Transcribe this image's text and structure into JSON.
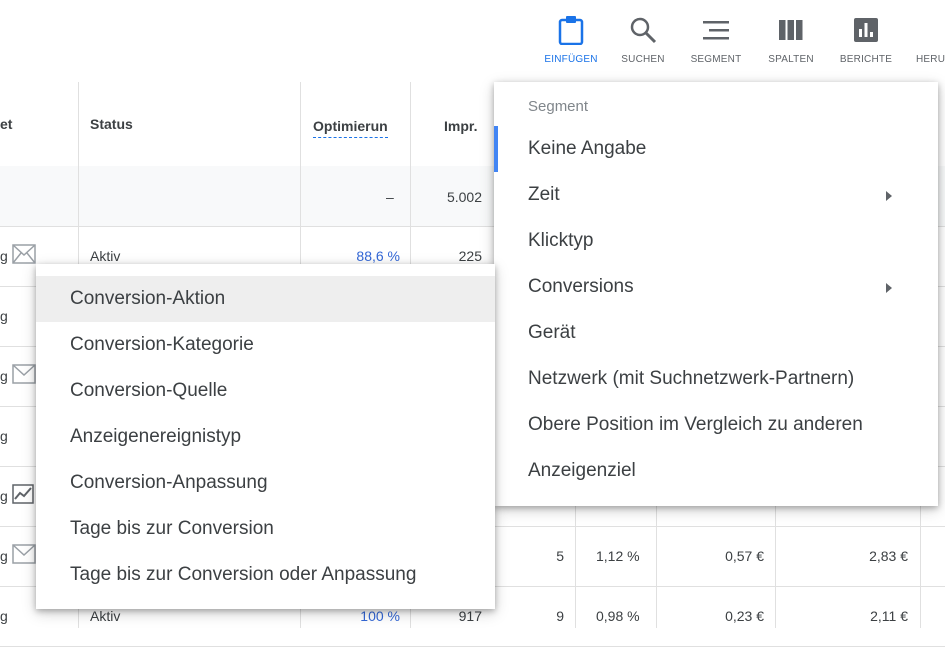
{
  "toolbar": {
    "items": [
      {
        "label": "EINFÜGEN",
        "icon": "clipboard-icon",
        "active": true
      },
      {
        "label": "SUCHEN",
        "icon": "search-icon"
      },
      {
        "label": "SEGMENT",
        "icon": "segment-icon"
      },
      {
        "label": "SPALTEN",
        "icon": "columns-icon"
      },
      {
        "label": "BERICHTE",
        "icon": "reports-icon"
      },
      {
        "label": "HERU",
        "icon": "download-icon"
      }
    ],
    "accent": "#1a73e8"
  },
  "table": {
    "headers": {
      "col0": "et",
      "status": "Status",
      "optimization": "Optimierun",
      "impressions": "Impr."
    },
    "total_row": {
      "optimization": "–",
      "impressions": "5.002"
    },
    "rows": [
      {
        "col0": "g",
        "status": "Aktiv",
        "optimization": "88,6 %",
        "impressions": "225"
      },
      {
        "col0": "g"
      },
      {
        "col0": "g"
      },
      {
        "col0": "g"
      },
      {
        "col0": "g"
      },
      {
        "col0": "g",
        "clicks": "5",
        "ctr": "1,12 %",
        "cpc": "0,57 €",
        "cost": "2,83 €"
      },
      {
        "col0": "g",
        "status": "Aktiv",
        "optimization": "100 %",
        "impressions": "917",
        "clicks": "9",
        "ctr": "0,98 %",
        "cpc": "0,23 €",
        "cost": "2,11 €"
      }
    ]
  },
  "segment_menu": {
    "header": "Segment",
    "items": [
      {
        "label": "Keine Angabe",
        "selected": true
      },
      {
        "label": "Zeit",
        "submenu": true
      },
      {
        "label": "Klicktyp"
      },
      {
        "label": "Conversions",
        "submenu": true
      },
      {
        "label": "Gerät"
      },
      {
        "label": "Netzwerk (mit Suchnetzwerk-Partnern)"
      },
      {
        "label": "Obere Position im Vergleich zu anderen"
      },
      {
        "label": "Anzeigenziel"
      }
    ]
  },
  "conversions_submenu": {
    "items": [
      {
        "label": "Conversion-Aktion",
        "highlighted": true
      },
      {
        "label": "Conversion-Kategorie"
      },
      {
        "label": "Conversion-Quelle"
      },
      {
        "label": "Anzeigenereignistyp"
      },
      {
        "label": "Conversion-Anpassung"
      },
      {
        "label": "Tage bis zur Conversion"
      },
      {
        "label": "Tage bis zur Conversion oder Anpassung"
      }
    ]
  }
}
